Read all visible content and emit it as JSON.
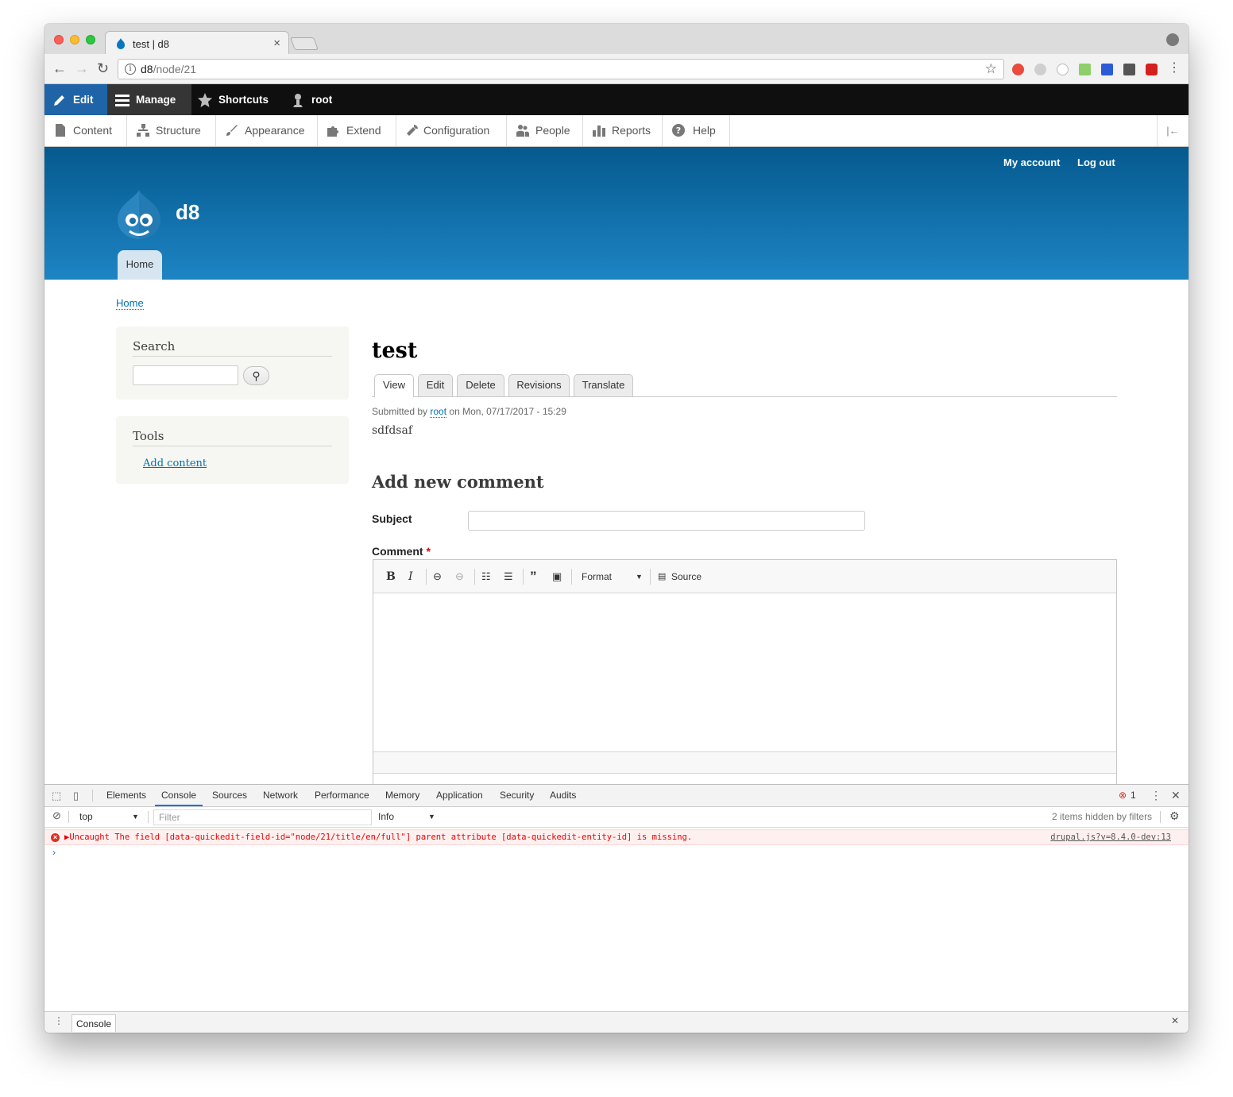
{
  "browser": {
    "tab_title": "test | d8",
    "url_host": "d8",
    "url_path": "/node/21"
  },
  "toolbar": {
    "edit": "Edit",
    "manage": "Manage",
    "shortcuts": "Shortcuts",
    "user": "root"
  },
  "tray": {
    "items": [
      "Content",
      "Structure",
      "Appearance",
      "Extend",
      "Configuration",
      "People",
      "Reports",
      "Help"
    ]
  },
  "header": {
    "my_account": "My account",
    "log_out": "Log out",
    "site_name": "d8",
    "home_tab": "Home"
  },
  "breadcrumb": "Home",
  "sidebar": {
    "search_title": "Search",
    "tools_title": "Tools",
    "add_content": "Add content"
  },
  "node": {
    "title": "test",
    "tabs": [
      "View",
      "Edit",
      "Delete",
      "Revisions",
      "Translate"
    ],
    "submitted_prefix": "Submitted by",
    "author": "root",
    "submitted_suffix": "on Mon, 07/17/2017 - 15:29",
    "body": "sdfdsaf"
  },
  "comment": {
    "heading": "Add new comment",
    "subject_label": "Subject",
    "comment_label": "Comment",
    "required_mark": "*",
    "format_label": "Format",
    "source_label": "Source"
  },
  "devtools": {
    "tabs": [
      "Elements",
      "Console",
      "Sources",
      "Network",
      "Performance",
      "Memory",
      "Application",
      "Security",
      "Audits"
    ],
    "error_count": "1",
    "context": "top",
    "filter_placeholder": "Filter",
    "level": "Info",
    "hidden_note": "2 items hidden by filters",
    "error_message": "Uncaught The field [data-quickedit-field-id=\"node/21/title/en/full\"] parent attribute [data-quickedit-entity-id] is missing.",
    "error_source": "drupal.js?v=8.4.0-dev:13",
    "drawer_tab": "Console"
  },
  "colors": {
    "toolbar_bg": "#0f0f0f",
    "edit_accent": "#1f64a7",
    "header_top": "#055a8f",
    "header_bottom": "#1d84c3",
    "link": "#0071b3",
    "error": "#e00000"
  }
}
